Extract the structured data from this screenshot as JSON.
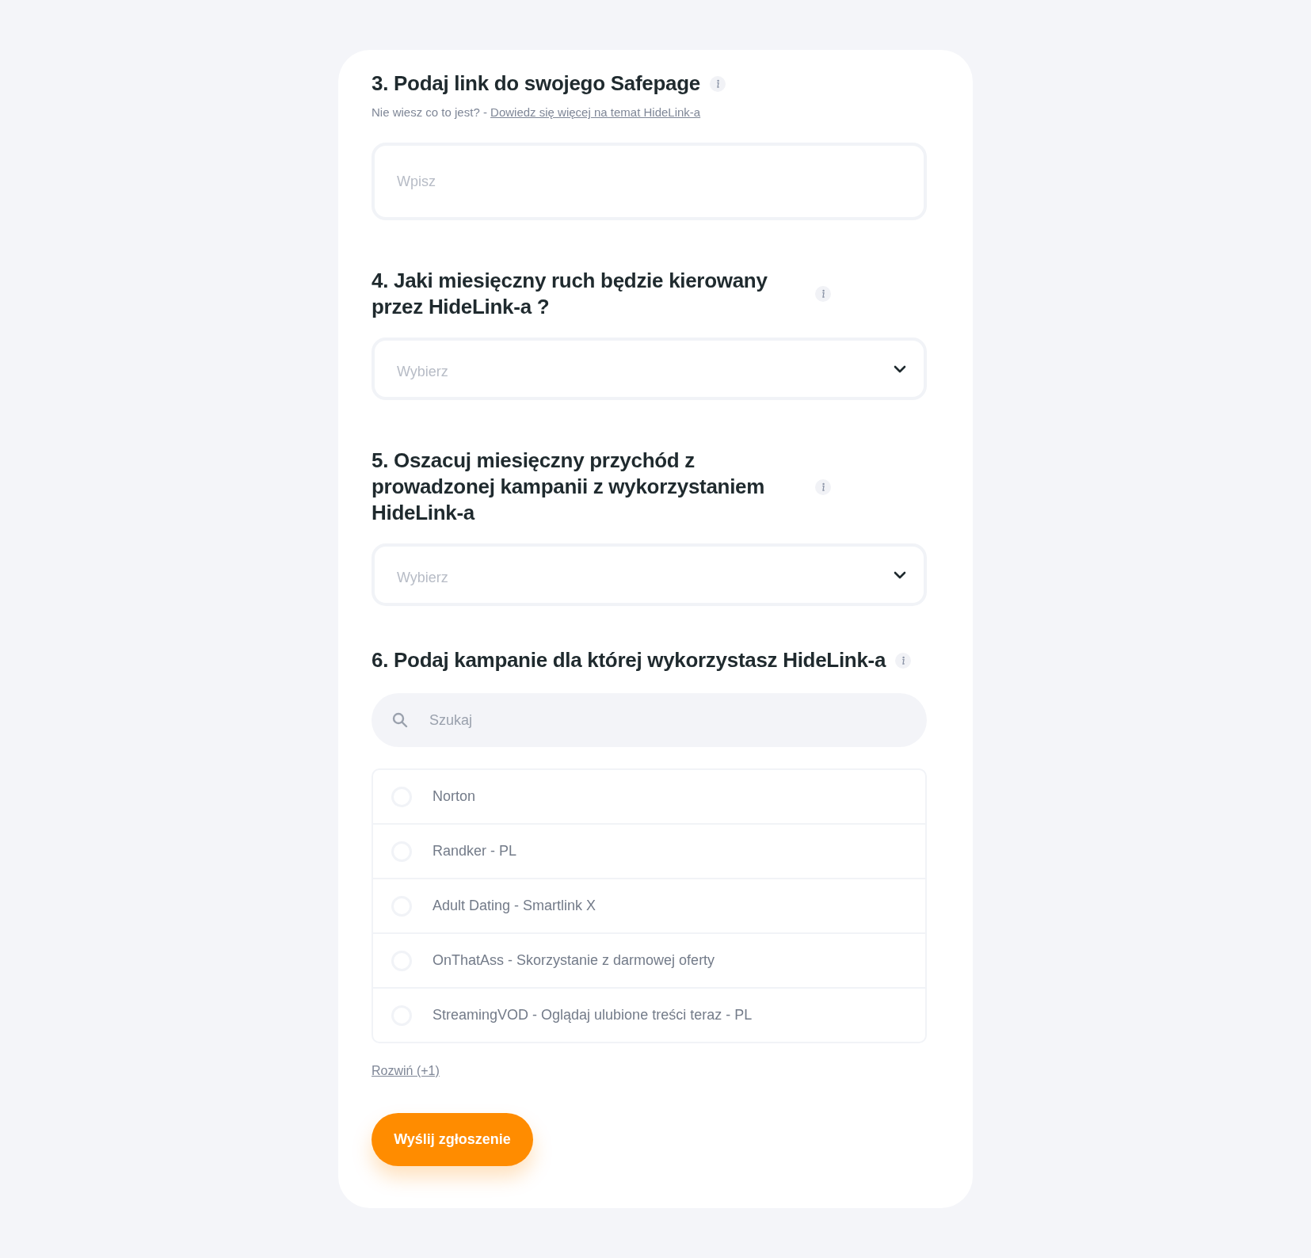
{
  "questions": [
    {
      "number": "3.",
      "title": "Podaj link do swojego Safepage",
      "kind": "text",
      "hint": "Nie wiesz co to jest? - ",
      "hint_link": "Dowiedz się więcej na temat HideLink-a",
      "placeholder": "Wpisz"
    },
    {
      "number": "4.",
      "title": "Jaki miesięczny ruch będzie kierowany przez HideLink-a ?",
      "kind": "select",
      "placeholder": "Wybierz"
    },
    {
      "number": "5.",
      "title": "Oszacuj miesięczny przychód z prowadzonej kampanii z wykorzystaniem HideLink-a",
      "kind": "select",
      "placeholder": "Wybierz"
    },
    {
      "number": "6.",
      "title": "Podaj kampanie dla której wykorzystasz HideLink-a",
      "kind": "choice",
      "placeholder": "Szukaj",
      "options": [
        {
          "label": "Norton",
          "selected": false
        },
        {
          "label": "Randker - PL",
          "selected": false
        },
        {
          "label": "Adult Dating - Smartlink X",
          "selected": false
        },
        {
          "label": "OnThatAss - Skorzystanie z darmowej oferty",
          "selected": false
        },
        {
          "label": "StreamingVOD - Oglądaj ulubione treści teraz - PL",
          "selected": false
        }
      ],
      "more_link": "Rozwiń (+1)"
    }
  ],
  "submit": "Wyślij zgłoszenie"
}
